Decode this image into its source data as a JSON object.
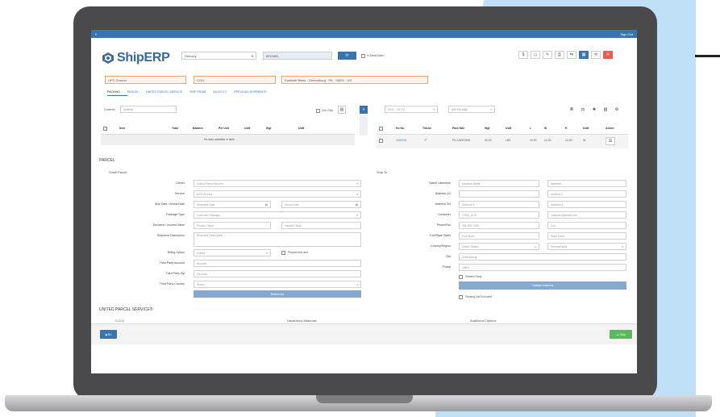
{
  "app": {
    "menu_glyph": "≡",
    "user_text": "Sign Out",
    "logo": "ShipERP"
  },
  "header": {
    "mode": "Delivery",
    "number": "8010461",
    "go": "⟳",
    "inbound_label": "Is Break Bulk?"
  },
  "toolbar": {
    "dollar": "$",
    "b1": "▭",
    "b2": "✎",
    "b3": "⎙",
    "b4": "⇆",
    "b5": "▦",
    "b6": "⟲",
    "b7": "✕"
  },
  "carrier_row": {
    "service": "UPS Ground",
    "mode": "COLL",
    "address": "Eastside Bikes · Greensburg · PA · 15601 · US"
  },
  "tabs": [
    "PACKING",
    "PARCEL",
    "UNITED PARCEL SERVICE",
    "SHIP FROM",
    "SALES TX",
    "PREVIOUS SHIPMENTS"
  ],
  "packing": {
    "contents_label": "Contents",
    "contents_ph": "Material",
    "doc_only": "Doc Only",
    "cols": [
      "Item",
      "Total",
      "Balance",
      "Per Unit",
      "UoM",
      "Wgt",
      "UoM"
    ],
    "empty": "No data available in table"
  },
  "packages": {
    "dd1": "0002 - Ltd PU",
    "dd2": "Add Package",
    "cols": [
      "Hu No.",
      "Tracks",
      "Pack Mat",
      "Wgt",
      "UoM",
      "L",
      "W",
      "H",
      "UoM",
      "Action"
    ],
    "row": {
      "hu": "1000728",
      "track": "✔",
      "mat": "PK-CARTONS",
      "wgt": "30.00",
      "uom": "LBS",
      "l": "10.00",
      "w": "12.00",
      "h": "10.00",
      "uom2": "IN",
      "act": "☰"
    }
  },
  "parcel_title": "PARCEL",
  "small_parcel": "Small Parcel",
  "ship_to": "Ship To",
  "left_form": [
    {
      "label": "Carrier",
      "value": "United Parcel Service"
    },
    {
      "label": "Service",
      "value": "UPS Ground"
    },
    {
      "label": "Ship Date / Arrival Date",
      "value": "Shipment Date",
      "value2": "Arrival Date"
    },
    {
      "label": "Package Type",
      "value": "Customer Package"
    },
    {
      "label": "Declared / Insured Value",
      "value": "Declare Value",
      "value2": "Insured Value"
    },
    {
      "label": "Shipment Description",
      "value": "Shipment Description"
    },
    {
      "label": "Billing Option",
      "value": "Collect",
      "extra": "Prepaid and add"
    },
    {
      "label": "Third Party Account",
      "value": "Account"
    },
    {
      "label": "Third Party Zip",
      "value": "Zip code"
    },
    {
      "label": "Third Party Country",
      "value": "Select..."
    }
  ],
  "reference_btn": "Reference",
  "right_form": [
    {
      "label": "Name / Attention",
      "value": "Eastside Bikes",
      "value2": "Attention"
    },
    {
      "label": "Address 1/2",
      "value": "",
      "value2": "Address 2"
    },
    {
      "label": "Address 3/4",
      "value": "Address 3",
      "value2": "Address 4"
    },
    {
      "label": "Customer",
      "value": "10011_ACR",
      "value2": "customer@email.com"
    },
    {
      "label": "Phone/Fax",
      "value": "555-999-7020",
      "value2": "Fax"
    },
    {
      "label": "Fed/State TaxID",
      "value": "Fed TaxID",
      "value2": "State TaxID"
    },
    {
      "label": "Country/Region",
      "value": "United States",
      "value2": "Pennsylvania"
    },
    {
      "label": "City",
      "value": "Greensburg"
    },
    {
      "label": "Postal",
      "value": "15601"
    }
  ],
  "residential": "Related Party",
  "validate_btn": "Validate Address",
  "packing_enclosed": "Packing List Enclosed",
  "ups_title": "UNITED PARCEL SERVICE®",
  "ups_cols": [
    "C.O.D",
    "Hazardous Materials",
    "Additional Options"
  ],
  "footer": {
    "back": "◀ BC",
    "ship": "☁ Ship"
  },
  "colors": {
    "accent": "#3a74b0",
    "orange": "#f0a36a",
    "green": "#5cb85c",
    "red": "#e8604c"
  }
}
